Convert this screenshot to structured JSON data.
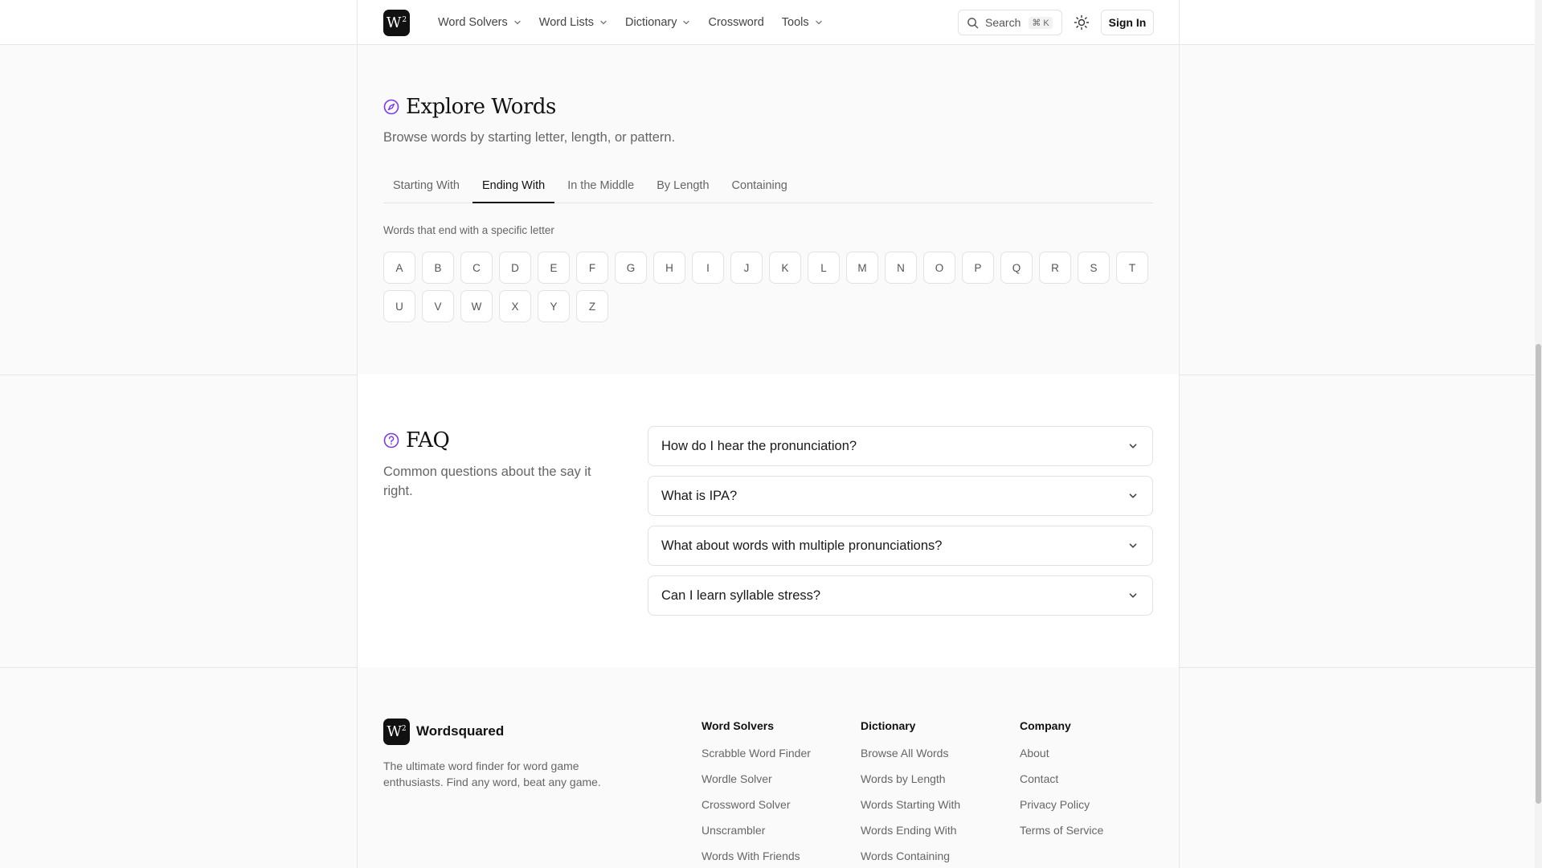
{
  "header": {
    "logo_text": "W",
    "logo_sup": "2",
    "nav": [
      {
        "label": "Word Solvers",
        "has_menu": true
      },
      {
        "label": "Word Lists",
        "has_menu": true
      },
      {
        "label": "Dictionary",
        "has_menu": true
      },
      {
        "label": "Crossword",
        "has_menu": false
      },
      {
        "label": "Tools",
        "has_menu": true
      }
    ],
    "search_label": "Search",
    "search_shortcut": "⌘ K",
    "signin_label": "Sign In"
  },
  "explore": {
    "title": "Explore Words",
    "subtitle": "Browse words by starting letter, length, or pattern.",
    "tabs": [
      {
        "label": "Starting With",
        "active": false
      },
      {
        "label": "Ending With",
        "active": true
      },
      {
        "label": "In the Middle",
        "active": false
      },
      {
        "label": "By Length",
        "active": false
      },
      {
        "label": "Containing",
        "active": false
      }
    ],
    "caption": "Words that end with a specific letter",
    "letters": [
      "A",
      "B",
      "C",
      "D",
      "E",
      "F",
      "G",
      "H",
      "I",
      "J",
      "K",
      "L",
      "M",
      "N",
      "O",
      "P",
      "Q",
      "R",
      "S",
      "T",
      "U",
      "V",
      "W",
      "X",
      "Y",
      "Z"
    ]
  },
  "faq": {
    "title": "FAQ",
    "subtitle": "Common questions about the say it right.",
    "items": [
      "How do I hear the pronunciation?",
      "What is IPA?",
      "What about words with multiple pronunciations?",
      "Can I learn syllable stress?"
    ]
  },
  "footer": {
    "brand": "Wordsquared",
    "description": "The ultimate word finder for word game enthusiasts. Find any word, beat any game.",
    "columns": [
      {
        "title": "Word Solvers",
        "links": [
          "Scrabble Word Finder",
          "Wordle Solver",
          "Crossword Solver",
          "Unscrambler",
          "Words With Friends"
        ]
      },
      {
        "title": "Dictionary",
        "links": [
          "Browse All Words",
          "Words by Length",
          "Words Starting With",
          "Words Ending With",
          "Words Containing"
        ]
      },
      {
        "title": "Company",
        "links": [
          "About",
          "Contact",
          "Privacy Policy",
          "Terms of Service"
        ]
      }
    ]
  },
  "colors": {
    "accent": "#7c3aed",
    "text": "#1a1a1a",
    "muted": "#666666",
    "border": "#e2e2e2"
  }
}
